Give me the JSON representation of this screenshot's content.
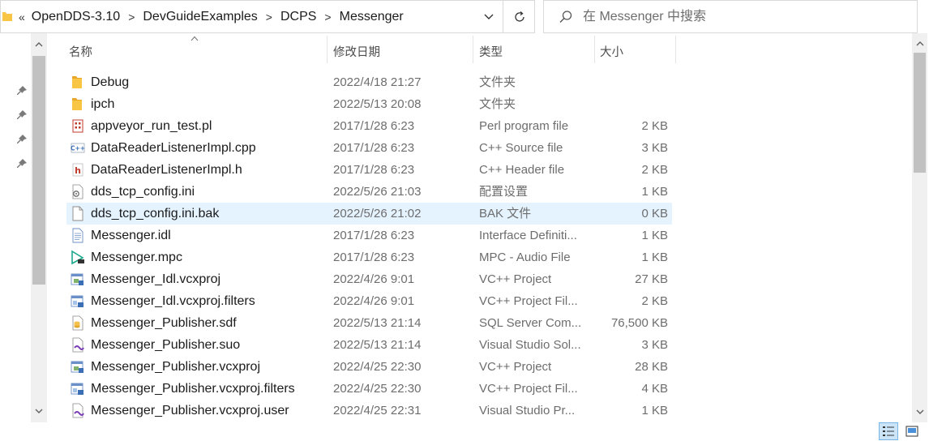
{
  "address": {
    "separator": "«",
    "crumb_separator": ">",
    "crumbs": [
      "OpenDDS-3.10",
      "DevGuideExamples",
      "DCPS",
      "Messenger"
    ]
  },
  "search": {
    "placeholder": "在 Messenger 中搜索"
  },
  "columns": {
    "name": "名称",
    "date": "修改日期",
    "type": "类型",
    "size": "大小"
  },
  "files": [
    {
      "name": "Debug",
      "date": "2022/4/18 21:27",
      "type": "文件夹",
      "size": "",
      "icon": "folder-icon"
    },
    {
      "name": "ipch",
      "date": "2022/5/13 20:08",
      "type": "文件夹",
      "size": "",
      "icon": "folder-icon"
    },
    {
      "name": "appveyor_run_test.pl",
      "date": "2017/1/28 6:23",
      "type": "Perl program file",
      "size": "2 KB",
      "icon": "perl-file-icon"
    },
    {
      "name": "DataReaderListenerImpl.cpp",
      "date": "2017/1/28 6:23",
      "type": "C++ Source file",
      "size": "3 KB",
      "icon": "cpp-file-icon"
    },
    {
      "name": "DataReaderListenerImpl.h",
      "date": "2017/1/28 6:23",
      "type": "C++ Header file",
      "size": "2 KB",
      "icon": "header-file-icon"
    },
    {
      "name": "dds_tcp_config.ini",
      "date": "2022/5/26 21:03",
      "type": "配置设置",
      "size": "1 KB",
      "icon": "config-file-icon"
    },
    {
      "name": "dds_tcp_config.ini.bak",
      "date": "2022/5/26 21:02",
      "type": "BAK 文件",
      "size": "0 KB",
      "icon": "blank-file-icon",
      "selected": true
    },
    {
      "name": "Messenger.idl",
      "date": "2017/1/28 6:23",
      "type": "Interface Definiti...",
      "size": "1 KB",
      "icon": "text-file-icon"
    },
    {
      "name": "Messenger.mpc",
      "date": "2017/1/28 6:23",
      "type": "MPC - Audio File",
      "size": "1 KB",
      "icon": "media-file-icon"
    },
    {
      "name": "Messenger_Idl.vcxproj",
      "date": "2022/4/26 9:01",
      "type": "VC++ Project",
      "size": "27 KB",
      "icon": "vcxproj-icon"
    },
    {
      "name": "Messenger_Idl.vcxproj.filters",
      "date": "2022/4/26 9:01",
      "type": "VC++ Project Fil...",
      "size": "2 KB",
      "icon": "filters-file-icon"
    },
    {
      "name": "Messenger_Publisher.sdf",
      "date": "2022/5/13 21:14",
      "type": "SQL Server Com...",
      "size": "76,500 KB",
      "icon": "sdf-file-icon"
    },
    {
      "name": "Messenger_Publisher.suo",
      "date": "2022/5/13 21:14",
      "type": "Visual Studio Sol...",
      "size": "3 KB",
      "icon": "vs-solution-icon"
    },
    {
      "name": "Messenger_Publisher.vcxproj",
      "date": "2022/4/25 22:30",
      "type": "VC++ Project",
      "size": "28 KB",
      "icon": "vcxproj-icon"
    },
    {
      "name": "Messenger_Publisher.vcxproj.filters",
      "date": "2022/4/25 22:30",
      "type": "VC++ Project Fil...",
      "size": "4 KB",
      "icon": "filters-file-icon"
    },
    {
      "name": "Messenger_Publisher.vcxproj.user",
      "date": "2022/4/25 22:31",
      "type": "Visual Studio Pr...",
      "size": "1 KB",
      "icon": "vs-user-icon"
    }
  ],
  "colors": {
    "selection": "#e5f3ff",
    "accent": "#0078d7",
    "folder": "#f8c544"
  }
}
